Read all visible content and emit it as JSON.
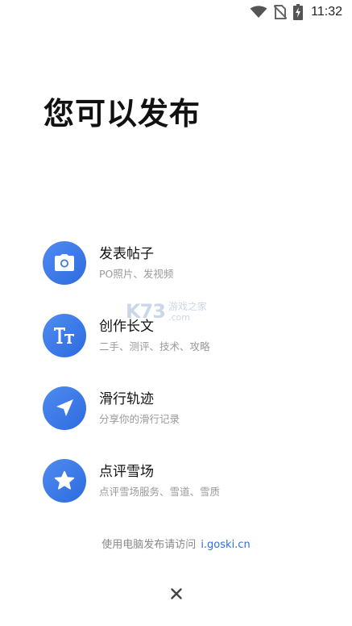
{
  "status_bar": {
    "time": "11:32",
    "icons": [
      "wifi-icon",
      "no-sim-icon",
      "battery-charging-icon"
    ]
  },
  "page": {
    "title": "您可以发布"
  },
  "options": [
    {
      "title": "发表帖子",
      "subtitle": "PO照片、发视频",
      "icon": "camera-icon"
    },
    {
      "title": "创作长文",
      "subtitle": "二手、测评、技术、攻略",
      "icon": "text-format-icon"
    },
    {
      "title": "滑行轨迹",
      "subtitle": "分享你的滑行记录",
      "icon": "navigation-arrow-icon"
    },
    {
      "title": "点评雪场",
      "subtitle": "点评雪场服务、雪道、雪质",
      "icon": "star-icon"
    }
  ],
  "footer": {
    "hint": "使用电脑发布请访问",
    "link": "i.goski.cn"
  },
  "watermark": {
    "logo": "K73",
    "cn": "游戏之家",
    "domain": ".com"
  },
  "colors": {
    "accent": "#2d6be0",
    "accent_light": "#4f8bf0",
    "link": "#2f6fd6"
  }
}
